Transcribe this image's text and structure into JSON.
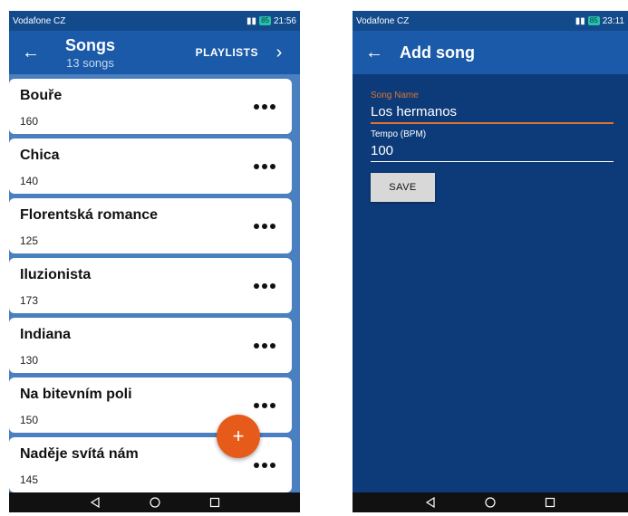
{
  "left": {
    "status": {
      "carrier": "Vodafone CZ",
      "battery": "85",
      "time": "21:56"
    },
    "appbar": {
      "title": "Songs",
      "subtitle": "13 songs",
      "playlists_label": "PLAYLISTS"
    },
    "songs": [
      {
        "name": "Bouře",
        "tempo": "160"
      },
      {
        "name": "Chica",
        "tempo": "140"
      },
      {
        "name": "Florentská romance",
        "tempo": "125"
      },
      {
        "name": "Iluzionista",
        "tempo": "173"
      },
      {
        "name": "Indiana",
        "tempo": "130"
      },
      {
        "name": "Na bitevním poli",
        "tempo": "150"
      },
      {
        "name": "Naděje svítá nám",
        "tempo": "145"
      }
    ],
    "fab_label": "+"
  },
  "right": {
    "status": {
      "carrier": "Vodafone CZ",
      "battery": "85",
      "time": "23:11"
    },
    "appbar": {
      "title": "Add song"
    },
    "form": {
      "song_name_label": "Song Name",
      "song_name_value": "Los hermanos",
      "tempo_label": "Tempo (BPM)",
      "tempo_value": "100",
      "save_label": "SAVE"
    }
  },
  "colors": {
    "primary": "#1a5aa8",
    "list_background": "#4a7fc0",
    "form_background": "#0d3b7a",
    "accent": "#e65a1a"
  },
  "icons": {
    "back": "arrow-left-icon",
    "more": "more-horizontal-icon",
    "nav_back": "triangle-back-icon",
    "nav_home": "circle-home-icon",
    "nav_recents": "square-recents-icon"
  }
}
